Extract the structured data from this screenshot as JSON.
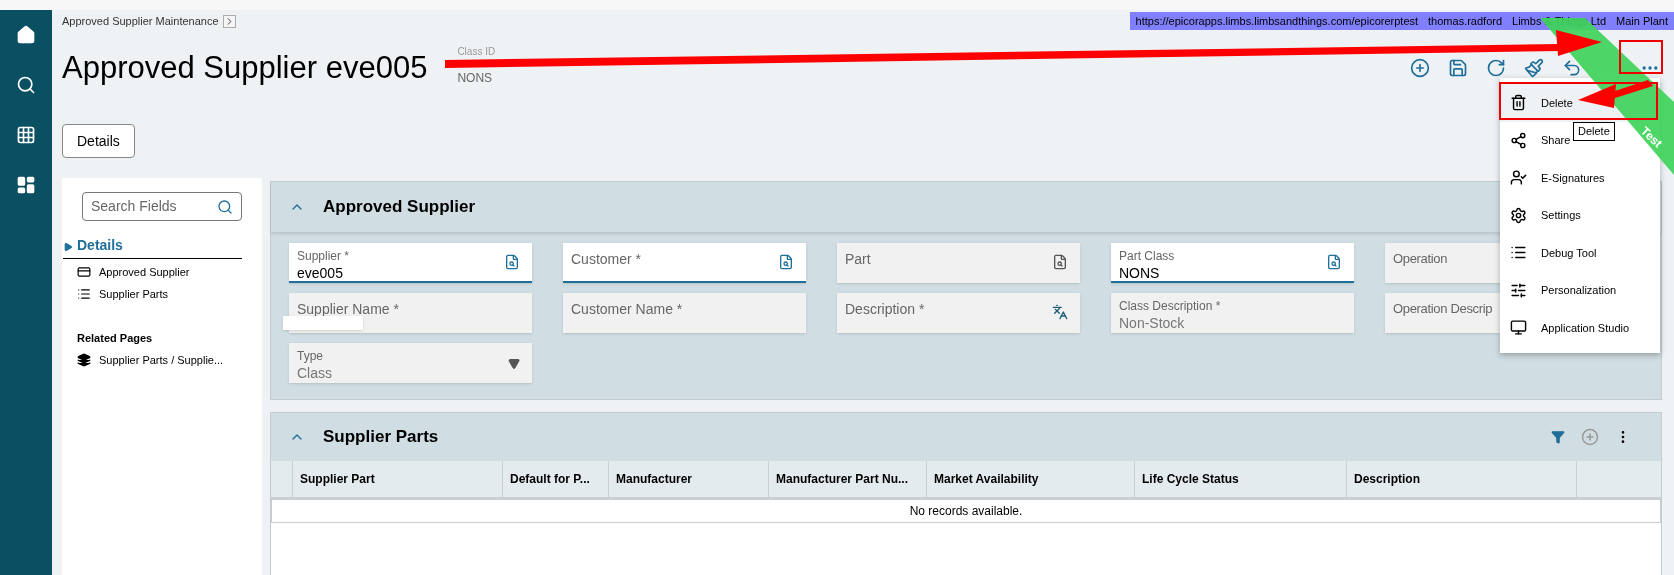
{
  "breadcrumb": {
    "label": "Approved Supplier Maintenance"
  },
  "environment_bar": [
    "https://epicorapps.limbs.limbsandthings.com/epicorerptest",
    "thomas.radford",
    "Limbs & Things Ltd",
    "Main Plant"
  ],
  "ribbon": {
    "label": "Test"
  },
  "title": "Approved Supplier eve005",
  "class_id": {
    "label": "Class ID",
    "value": "NONS"
  },
  "toolbar": [
    {
      "kind": "new"
    },
    {
      "kind": "save"
    },
    {
      "kind": "refresh"
    },
    {
      "kind": "clear"
    },
    {
      "kind": "undo"
    },
    {
      "kind": "more"
    }
  ],
  "details_button": "Details",
  "side_panel": {
    "search": {
      "placeholder": "Search Fields"
    },
    "sections": [
      {
        "label": "Details",
        "selected": true,
        "children": [
          {
            "label": "Approved Supplier",
            "kind": "card"
          },
          {
            "label": "Supplier Parts",
            "kind": "list"
          }
        ]
      }
    ],
    "related_title": "Related Pages",
    "related": [
      {
        "label": "Supplier Parts / Supplie...",
        "kind": "pages"
      }
    ]
  },
  "approved_supplier": {
    "title": "Approved Supplier",
    "expanded": true,
    "fields": [
      {
        "label": "Supplier *",
        "value": "eve005",
        "kind": "lookup",
        "disabled": false
      },
      {
        "label": "Customer *",
        "kind": "lookup",
        "disabled": false
      },
      {
        "label": "Part",
        "kind": "lookup",
        "disabled": true
      },
      {
        "label": "Part Class",
        "value": "NONS",
        "kind": "lookup",
        "disabled": false
      },
      {
        "label": "Operation",
        "kind": "text",
        "disabled": true
      },
      {
        "label": "Supplier Name *",
        "kind": "redacted",
        "disabled": true
      },
      {
        "label": "Customer Name *",
        "kind": "text",
        "disabled": true
      },
      {
        "label": "Description *",
        "kind": "translate",
        "disabled": true
      },
      {
        "label": "Class Description *",
        "value": "Non-Stock",
        "kind": "text",
        "disabled": true
      },
      {
        "label": "Operation Descrip",
        "kind": "text",
        "disabled": true
      },
      {
        "label": "Type",
        "value": "Class",
        "kind": "dropdown",
        "disabled": true
      }
    ]
  },
  "supplier_parts": {
    "title": "Supplier Parts",
    "expanded": true,
    "columns": [
      "Supplier Part",
      "Default for P...",
      "Manufacturer",
      "Manufacturer Part Nu...",
      "Market Availability",
      "Life Cycle Status",
      "Description"
    ],
    "empty_message": "No records available."
  },
  "menu": {
    "items": [
      {
        "label": "Delete",
        "kind": "delete",
        "highlighted": true
      },
      {
        "label": "Share",
        "kind": "share",
        "highlighted": false
      },
      {
        "label": "E-Signatures",
        "kind": "signature",
        "highlighted": false
      },
      {
        "label": "Settings",
        "kind": "settings",
        "highlighted": false
      },
      {
        "label": "Debug Tool",
        "kind": "debug",
        "highlighted": false
      },
      {
        "label": "Personalization",
        "kind": "personalize",
        "highlighted": false
      },
      {
        "label": "Application Studio",
        "kind": "studio",
        "highlighted": false
      }
    ],
    "tooltip": "Delete"
  }
}
